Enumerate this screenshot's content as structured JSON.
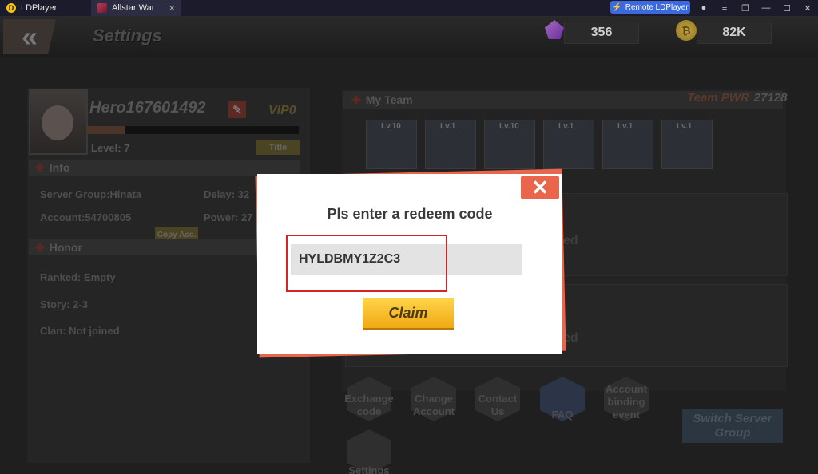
{
  "window": {
    "app_tab": "LDPlayer",
    "game_tab": "Allstar War",
    "remote_button": "Remote LDPlayer"
  },
  "header": {
    "title": "Settings",
    "gems": "356",
    "gold": "82K"
  },
  "profile": {
    "name": "Hero167601492",
    "vip": "VIP0",
    "level_label": "Level:",
    "level_value": "7",
    "title_button": "Title",
    "info_header": "Info",
    "server_group": "Server Group:Hinata",
    "delay": "Delay: 32",
    "account": "Account:54700805",
    "copy_button": "Copy Acc.",
    "power": "Power: 27",
    "honor_header": "Honor",
    "ranked": "Ranked: Empty",
    "story": "Story: 2-3",
    "clan": "Clan: Not joined",
    "xp_fraction": 0.18
  },
  "team": {
    "header": "My Team",
    "power_label": "Team PWR",
    "power_value": "27128",
    "heroes": [
      {
        "level": "Lv.10"
      },
      {
        "level": "Lv.1"
      },
      {
        "level": "Lv.10"
      },
      {
        "level": "Lv.1"
      },
      {
        "level": "Lv.1"
      },
      {
        "level": "Lv.1"
      }
    ],
    "slot_text": "ed"
  },
  "actions": {
    "exchange": "Exchange code",
    "change": "Change Account",
    "contact": "Contact Us",
    "faq": "FAQ",
    "binding": "Account binding event",
    "settings": "Settings",
    "switch": "Switch Server Group"
  },
  "modal": {
    "title": "Pls enter a redeem code",
    "code_value": "HYLDBMY1Z2C3",
    "claim_button": "Claim"
  }
}
